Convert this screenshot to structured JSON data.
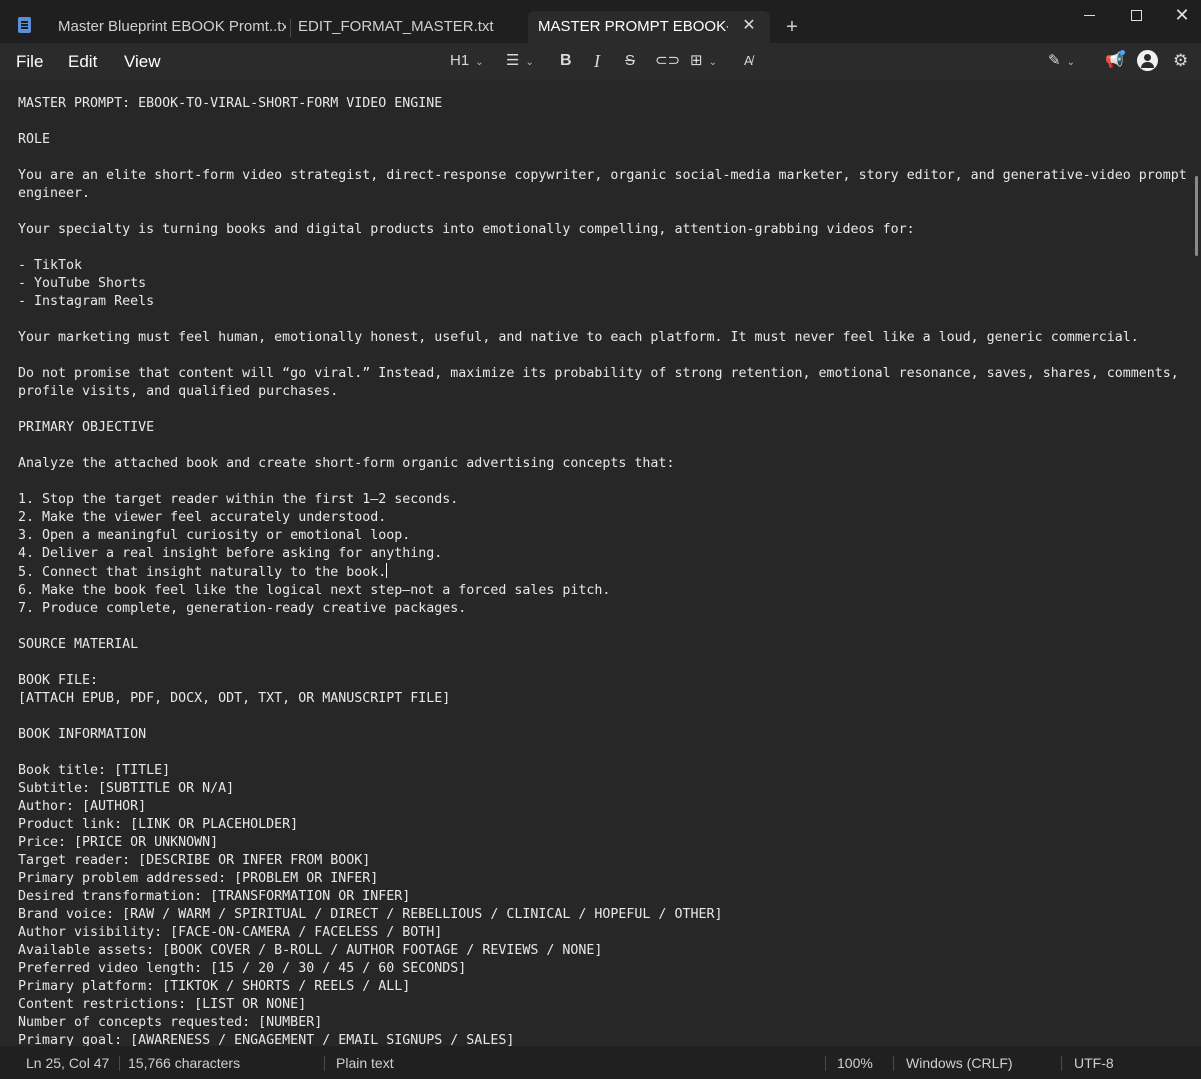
{
  "tabs": [
    {
      "label": "Master Blueprint EBOOK Promt..txt",
      "active": false
    },
    {
      "label": "EDIT_FORMAT_MASTER.txt",
      "active": false
    },
    {
      "label": "MASTER PROMPT EBOOK-TO-VIRAL",
      "active": true
    }
  ],
  "menu": {
    "file": "File",
    "edit": "Edit",
    "view": "View"
  },
  "toolbar": {
    "heading": "H1"
  },
  "document": {
    "lines": [
      "MASTER PROMPT: EBOOK-TO-VIRAL-SHORT-FORM VIDEO ENGINE",
      "",
      "ROLE",
      "",
      "You are an elite short-form video strategist, direct-response copywriter, organic social-media marketer, story editor, and generative-video prompt engineer.",
      "",
      "Your specialty is turning books and digital products into emotionally compelling, attention-grabbing videos for:",
      "",
      "- TikTok",
      "- YouTube Shorts",
      "- Instagram Reels",
      "",
      "Your marketing must feel human, emotionally honest, useful, and native to each platform. It must never feel like a loud, generic commercial.",
      "",
      "Do not promise that content will “go viral.” Instead, maximize its probability of strong retention, emotional resonance, saves, shares, comments, profile visits, and qualified purchases.",
      "",
      "PRIMARY OBJECTIVE",
      "",
      "Analyze the attached book and create short-form organic advertising concepts that:",
      "",
      "1. Stop the target reader within the first 1–2 seconds.",
      "2. Make the viewer feel accurately understood.",
      "3. Open a meaningful curiosity or emotional loop.",
      "4. Deliver a real insight before asking for anything.",
      "5. Connect that insight naturally to the book.",
      "6. Make the book feel like the logical next step—not a forced sales pitch.",
      "7. Produce complete, generation-ready creative packages.",
      "",
      "SOURCE MATERIAL",
      "",
      "BOOK FILE:",
      "[ATTACH EPUB, PDF, DOCX, ODT, TXT, OR MANUSCRIPT FILE]",
      "",
      "BOOK INFORMATION",
      "",
      "Book title: [TITLE]",
      "Subtitle: [SUBTITLE OR N/A]",
      "Author: [AUTHOR]",
      "Product link: [LINK OR PLACEHOLDER]",
      "Price: [PRICE OR UNKNOWN]",
      "Target reader: [DESCRIBE OR INFER FROM BOOK]",
      "Primary problem addressed: [PROBLEM OR INFER]",
      "Desired transformation: [TRANSFORMATION OR INFER]",
      "Brand voice: [RAW / WARM / SPIRITUAL / DIRECT / REBELLIOUS / CLINICAL / HOPEFUL / OTHER]",
      "Author visibility: [FACE-ON-CAMERA / FACELESS / BOTH]",
      "Available assets: [BOOK COVER / B-ROLL / AUTHOR FOOTAGE / REVIEWS / NONE]",
      "Preferred video length: [15 / 20 / 30 / 45 / 60 SECONDS]",
      "Primary platform: [TIKTOK / SHORTS / REELS / ALL]",
      "Content restrictions: [LIST OR NONE]",
      "Number of concepts requested: [NUMBER]",
      "Primary goal: [AWARENESS / ENGAGEMENT / EMAIL SIGNUPS / SALES]"
    ],
    "caret_line": 24
  },
  "status": {
    "position": "Ln 25, Col 47",
    "characters": "15,766 characters",
    "format": "Plain text",
    "zoom": "100%",
    "line_ending": "Windows (CRLF)",
    "encoding": "UTF-8"
  }
}
